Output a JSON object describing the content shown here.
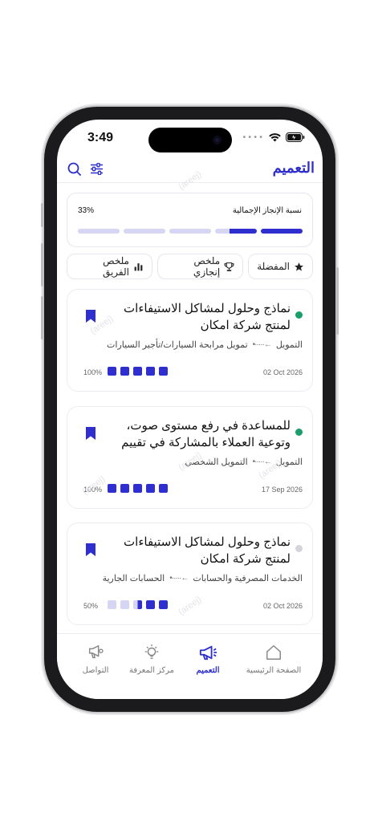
{
  "status": {
    "time": "3:49"
  },
  "header": {
    "title": "التعميم",
    "search_icon": "search-icon",
    "filter_icon": "sliders-icon"
  },
  "progress": {
    "label": "نسبة الإنجاز الإجمالية",
    "percent_text": "33%",
    "segments": 5,
    "filled_fraction": 0.33
  },
  "filters": [
    {
      "label": "المفضلة",
      "icon": "star-icon"
    },
    {
      "label": "ملخص إنجازي",
      "icon": "trophy-icon"
    },
    {
      "label": "ملخص الفريق",
      "icon": "bar-chart-icon"
    }
  ],
  "cards": [
    {
      "title": "نماذج وحلول لمشاكل الاستيفاءات لمنتج شركة امكان",
      "path_from": "التمويل",
      "path_to": "تمويل مرابحة السيارات/تأجير السيارات",
      "date": "02 Oct 2026",
      "percent": "100%",
      "status_color": "#1a9e6b",
      "steps": [
        1,
        1,
        1,
        1,
        1
      ]
    },
    {
      "title": "للمساعدة في رفع مستوى صوت، وتوعية العملاء بالمشاركة في تقييم الفروع الغير...",
      "path_from": "التمويل",
      "path_to": "التمويل الشخصي",
      "date": "17 Sep 2026",
      "percent": "100%",
      "status_color": "#1a9e6b",
      "steps": [
        1,
        1,
        1,
        1,
        1
      ]
    },
    {
      "title": "نماذج وحلول لمشاكل الاستيفاءات لمنتج شركة امكان",
      "path_from": "الخدمات المصرفية والحسابات",
      "path_to": "الحسابات الجارية",
      "date": "02 Oct 2026",
      "percent": "50%",
      "status_color": "#d4d4da",
      "steps": [
        0,
        0,
        0.5,
        1,
        1
      ]
    }
  ],
  "tabs": [
    {
      "label": "الصفحة الرئيسية",
      "icon": "home-icon",
      "active": false
    },
    {
      "label": "التعميم",
      "icon": "megaphone-icon",
      "active": true
    },
    {
      "label": "مركز المعرفة",
      "icon": "lightbulb-icon",
      "active": false
    },
    {
      "label": "التواصل",
      "icon": "chat-icon",
      "active": false
    }
  ],
  "colors": {
    "accent": "#2f2fcf",
    "accent_light": "#d6d6f4",
    "success": "#1a9e6b"
  }
}
